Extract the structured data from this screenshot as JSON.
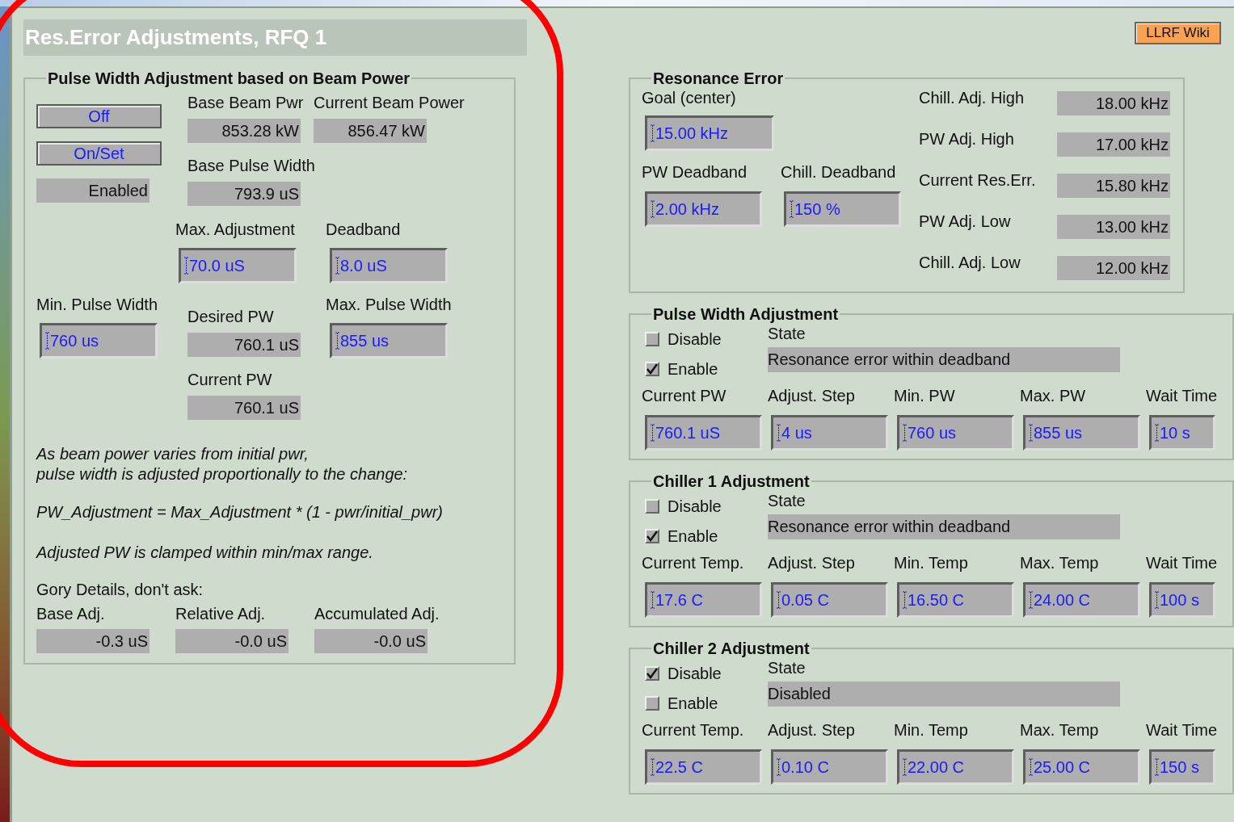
{
  "window": {
    "title": "Res.Error Adjustments, RFQ 1"
  },
  "wiki_button": "LLRF Wiki",
  "beam_power_group": {
    "title": "Pulse Width Adjustment based on Beam Power",
    "buttons": [
      "Off",
      "On/Set"
    ],
    "status": "Enabled",
    "base_beam_pwr": {
      "label": "Base Beam Pwr",
      "value": "853.28 kW"
    },
    "current_beam_power": {
      "label": "Current Beam Power",
      "value": "856.47 kW"
    },
    "base_pulse_width": {
      "label": "Base Pulse Width",
      "value": "793.9 uS"
    },
    "max_adjustment": {
      "label": "Max. Adjustment",
      "value": "70.0 uS"
    },
    "deadband": {
      "label": "Deadband",
      "value": "8.0 uS"
    },
    "min_pulse_width": {
      "label": "Min. Pulse Width",
      "value": "760 us"
    },
    "desired_pw": {
      "label": "Desired PW",
      "value": "760.1 uS"
    },
    "max_pulse_width": {
      "label": "Max. Pulse Width",
      "value": "855 us"
    },
    "current_pw": {
      "label": "Current PW",
      "value": "760.1 uS"
    },
    "note": "As beam power varies from initial pwr,\npulse width is adjusted proportionally to the change:",
    "formula": "PW_Adjustment = Max_Adjustment * (1 - pwr/initial_pwr)",
    "clamp_note": "Adjusted PW is clamped within min/max range.",
    "details_heading": "Gory Details, don't ask:",
    "details": [
      {
        "label": "Base Adj.",
        "value": "-0.3 uS"
      },
      {
        "label": "Relative Adj.",
        "value": "-0.0 uS"
      },
      {
        "label": "Accumulated Adj.",
        "value": "-0.0 uS"
      }
    ]
  },
  "resonance_error": {
    "title": "Resonance Error",
    "goal": {
      "label": "Goal (center)",
      "value": "15.00 kHz"
    },
    "pw_deadband": {
      "label": "PW Deadband",
      "value": "2.00 kHz"
    },
    "chill_deadband": {
      "label": "Chill. Deadband",
      "value": "150 %"
    },
    "thresholds": [
      {
        "label": "Chill. Adj. High",
        "value": "18.00 kHz"
      },
      {
        "label": "PW Adj. High",
        "value": "17.00 kHz"
      },
      {
        "label": "Current Res.Err.",
        "value": "15.80 kHz"
      },
      {
        "label": "PW Adj. Low",
        "value": "13.00 kHz"
      },
      {
        "label": "Chill. Adj. Low",
        "value": "12.00 kHz"
      }
    ]
  },
  "adjustments": [
    {
      "title": "Pulse Width Adjustment",
      "options": [
        {
          "label": "Disable",
          "checked": false
        },
        {
          "label": "Enable",
          "checked": true
        }
      ],
      "state_label": "State",
      "state": "Resonance error within deadband",
      "fields": [
        {
          "label": "Current PW",
          "value": "760.1 uS"
        },
        {
          "label": "Adjust. Step",
          "value": "4 us"
        },
        {
          "label": "Min. PW",
          "value": "760 us"
        },
        {
          "label": "Max. PW",
          "value": "855 us"
        },
        {
          "label": "Wait Time",
          "value": "10 s"
        }
      ]
    },
    {
      "title": "Chiller 1 Adjustment",
      "options": [
        {
          "label": "Disable",
          "checked": false
        },
        {
          "label": "Enable",
          "checked": true
        }
      ],
      "state_label": "State",
      "state": "Resonance error within deadband",
      "fields": [
        {
          "label": "Current Temp.",
          "value": "17.6 C"
        },
        {
          "label": "Adjust. Step",
          "value": "0.05 C"
        },
        {
          "label": "Min. Temp",
          "value": "16.50 C"
        },
        {
          "label": "Max. Temp",
          "value": "24.00 C"
        },
        {
          "label": "Wait Time",
          "value": "100 s"
        }
      ]
    },
    {
      "title": "Chiller 2 Adjustment",
      "options": [
        {
          "label": "Disable",
          "checked": true
        },
        {
          "label": "Enable",
          "checked": false
        }
      ],
      "state_label": "State",
      "state": "Disabled",
      "fields": [
        {
          "label": "Current Temp.",
          "value": "22.5 C"
        },
        {
          "label": "Adjust. Step",
          "value": "0.10 C"
        },
        {
          "label": "Min. Temp",
          "value": "22.00 C"
        },
        {
          "label": "Max. Temp",
          "value": "25.00 C"
        },
        {
          "label": "Wait Time",
          "value": "150 s"
        }
      ]
    }
  ]
}
